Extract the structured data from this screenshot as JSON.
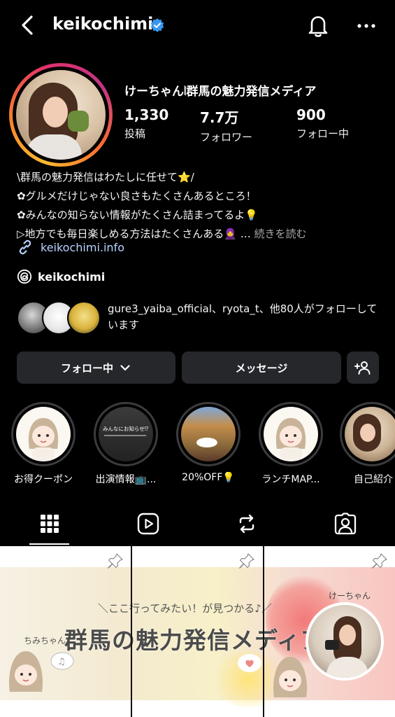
{
  "header": {
    "username": "keikochimi",
    "verified_color": "#3797f0",
    "icons": [
      "chevron-left-icon",
      "verified-badge-icon",
      "bell-icon",
      "more-horizontal-icon"
    ]
  },
  "profile": {
    "full_name": "けーちゃん⦚群馬の魅力発信メディア",
    "stats": {
      "posts": {
        "value": "1,330",
        "label": "投稿"
      },
      "followers": {
        "value": "7.7万",
        "label": "フォロワー"
      },
      "following": {
        "value": "900",
        "label": "フォロー中"
      }
    },
    "bio": [
      "\\群馬の魅力発信はわたしに任せて⭐/",
      "✿グルメだけじゃない良さもたくさんあるところ！",
      "✿みんなの知らない情報がたくさん詰まってるよ💡",
      "▷地方でも毎日楽しめる方法はたくさんある🧕"
    ],
    "bio_more": "続きを読む",
    "link": "keikochimi.info",
    "threads": "keikochimi",
    "mutual_text": "gure3_yaiba_official、ryota_t、他80人がフォローしています"
  },
  "buttons": {
    "following": "フォロー中",
    "message": "メッセージ"
  },
  "highlights": [
    {
      "label": "お得クーポン"
    },
    {
      "label": "出演情報📺..."
    },
    {
      "label": "20%OFF💡"
    },
    {
      "label": "ランチMAP..."
    },
    {
      "label": "自己紹介"
    }
  ],
  "highlight_thumb_text": "みんなにお知らせ⁉",
  "tabs": [
    "grid-icon",
    "reels-icon",
    "tagged-reposts-icon",
    "tagged-icon"
  ],
  "grid_banner": {
    "tagline": "＼ここ行ってみたい！が見つかる♪／",
    "title": "群馬の魅力発信メディア",
    "left_name": "ちみちゃん",
    "right_name": "けーちゃん"
  },
  "colors": {
    "background": "#000000",
    "button_bg": "#26272b",
    "link": "#b8d3ff",
    "muted": "#a8a8a8"
  }
}
